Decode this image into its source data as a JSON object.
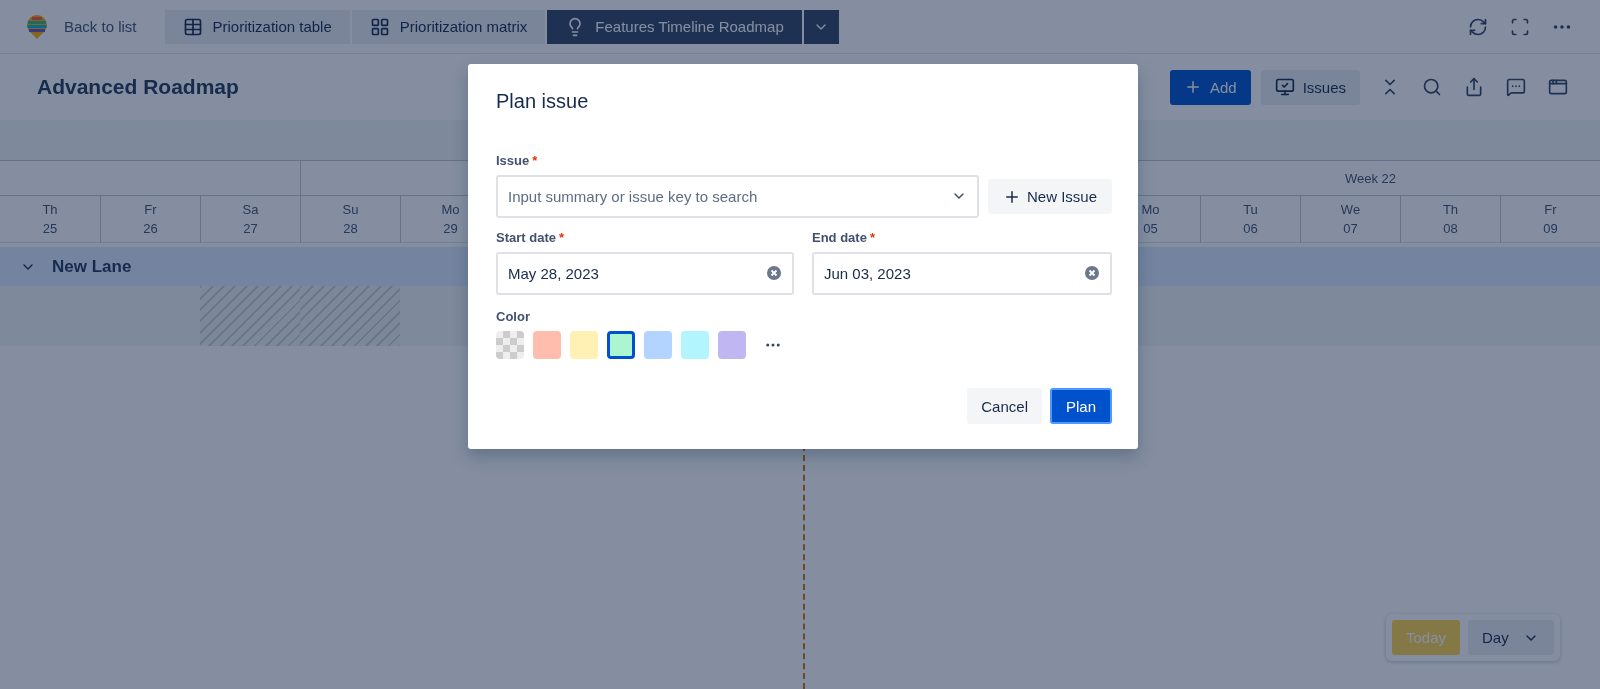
{
  "top_bar": {
    "back_link": "Back to list",
    "tabs": [
      {
        "kind": "table",
        "label": "Prioritization table",
        "selected": false
      },
      {
        "kind": "matrix",
        "label": "Prioritization matrix",
        "selected": false
      },
      {
        "kind": "timeline",
        "label": "Features Timeline Roadmap",
        "selected": true
      }
    ]
  },
  "header": {
    "title": "Advanced Roadmap",
    "add_button": "Add",
    "issues_button": "Issues"
  },
  "timeline": {
    "week_label": "Week 22",
    "days": [
      {
        "weekday": "Th",
        "date": "25",
        "weekend": false
      },
      {
        "weekday": "Fr",
        "date": "26",
        "weekend": false
      },
      {
        "weekday": "Sa",
        "date": "27",
        "weekend": true
      },
      {
        "weekday": "Su",
        "date": "28",
        "weekend": true
      },
      {
        "weekday": "Mo",
        "date": "29",
        "weekend": false
      },
      {
        "weekday": "Mo",
        "date": "05",
        "weekend": false
      },
      {
        "weekday": "Tu",
        "date": "06",
        "weekend": false
      },
      {
        "weekday": "We",
        "date": "07",
        "weekend": false
      },
      {
        "weekday": "Th",
        "date": "08",
        "weekend": false
      },
      {
        "weekday": "Fr",
        "date": "09",
        "weekend": false
      }
    ],
    "lanes": [
      {
        "title": "New Lane",
        "expanded": true
      }
    ]
  },
  "view_controls": {
    "today_button": "Today",
    "scale": "Day"
  },
  "dialog": {
    "title": "Plan issue",
    "fields": [
      {
        "kind": "select",
        "label": "Issue",
        "required_mark": "*",
        "placeholder": "Input summary or issue key to search"
      },
      {
        "kind": "date",
        "label": "Start date",
        "required_mark": "*",
        "value": "May 28, 2023"
      },
      {
        "kind": "date",
        "label": "End date",
        "required_mark": "*",
        "value": "Jun 03, 2023"
      }
    ],
    "new_issue_button": "New Issue",
    "color_label": "Color",
    "swatches": [
      {
        "kind": "none",
        "selected": false
      },
      {
        "kind": "color",
        "color": "#ffbdad",
        "selected": false
      },
      {
        "kind": "color",
        "color": "#fff0b3",
        "selected": false
      },
      {
        "kind": "color",
        "color": "#abf5d1",
        "selected": true
      },
      {
        "kind": "color",
        "color": "#b3d4ff",
        "selected": false
      },
      {
        "kind": "color",
        "color": "#b3f5ff",
        "selected": false
      },
      {
        "kind": "color",
        "color": "#c0b6f2",
        "selected": false
      }
    ],
    "buttons": [
      {
        "kind": "secondary",
        "label": "Cancel"
      },
      {
        "kind": "primary",
        "label": "Plan"
      }
    ]
  }
}
